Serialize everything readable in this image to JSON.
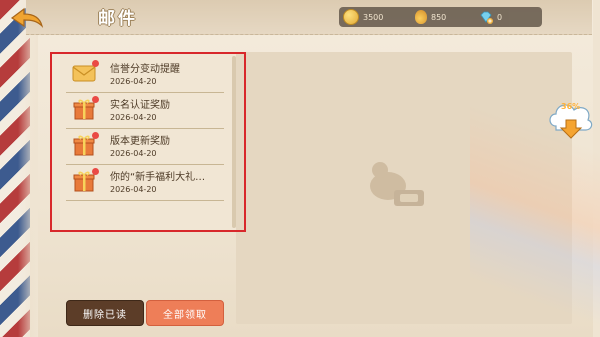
{
  "header": {
    "title": "邮件"
  },
  "currency": {
    "coins": "3500",
    "bag": "850",
    "gems": "0"
  },
  "mails": [
    {
      "title": "信誉分变动提醒",
      "date": "2026-04-20",
      "icon": "envelope-icon"
    },
    {
      "title": "实名认证奖励",
      "date": "2026-04-20",
      "icon": "gift-icon"
    },
    {
      "title": "版本更新奖励",
      "date": "2026-04-20",
      "icon": "gift-icon"
    },
    {
      "title": "你的“新手福利大礼…",
      "date": "2026-04-20",
      "icon": "gift-icon"
    }
  ],
  "buttons": {
    "delete_read": "删除已读",
    "claim_all": "全部领取"
  },
  "download": {
    "percent": "36%"
  },
  "colors": {
    "highlight_border": "#d8282b",
    "claim_button": "#ee7e58",
    "delete_button": "#5c3d28"
  }
}
